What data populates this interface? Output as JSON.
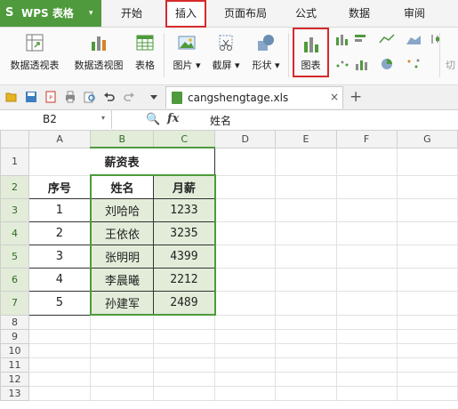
{
  "app": {
    "name": "WPS 表格",
    "logo": "S",
    "caret": "▾"
  },
  "menu": {
    "tabs": [
      "开始",
      "插入",
      "页面布局",
      "公式",
      "数据",
      "审阅"
    ],
    "active": "插入"
  },
  "ribbon": {
    "pivot_table": "数据透视表",
    "pivot_chart": "数据透视图",
    "table": "表格",
    "picture": "图片",
    "screenshot": "截屏",
    "shape": "形状",
    "chart": "图表",
    "more": "切",
    "dropdown_caret": "▾"
  },
  "document": {
    "filename": "cangshengtage.xls",
    "close": "×",
    "new_tab": "+"
  },
  "formula_bar": {
    "cell_ref": "B2",
    "fx_label": "fx",
    "zoom_symbol": "🔍",
    "value": "姓名",
    "caret": "▾"
  },
  "sheet": {
    "columns": [
      "A",
      "B",
      "C",
      "D",
      "E",
      "F",
      "G"
    ],
    "row_numbers": [
      "1",
      "2",
      "3",
      "4",
      "5",
      "6",
      "7",
      "8",
      "9",
      "10",
      "11",
      "12",
      "13"
    ],
    "title": "薪资表",
    "headers": [
      "序号",
      "姓名",
      "月薪"
    ],
    "rows": [
      [
        "1",
        "刘哈哈",
        "1233"
      ],
      [
        "2",
        "王依依",
        "3235"
      ],
      [
        "3",
        "张明明",
        "4399"
      ],
      [
        "4",
        "李晨曦",
        "2212"
      ],
      [
        "5",
        "孙建军",
        "2489"
      ]
    ]
  },
  "colors": {
    "accent_green": "#4e9a3c",
    "highlight_red": "#d52a2a",
    "selection_fill": "#e2ecd9"
  }
}
